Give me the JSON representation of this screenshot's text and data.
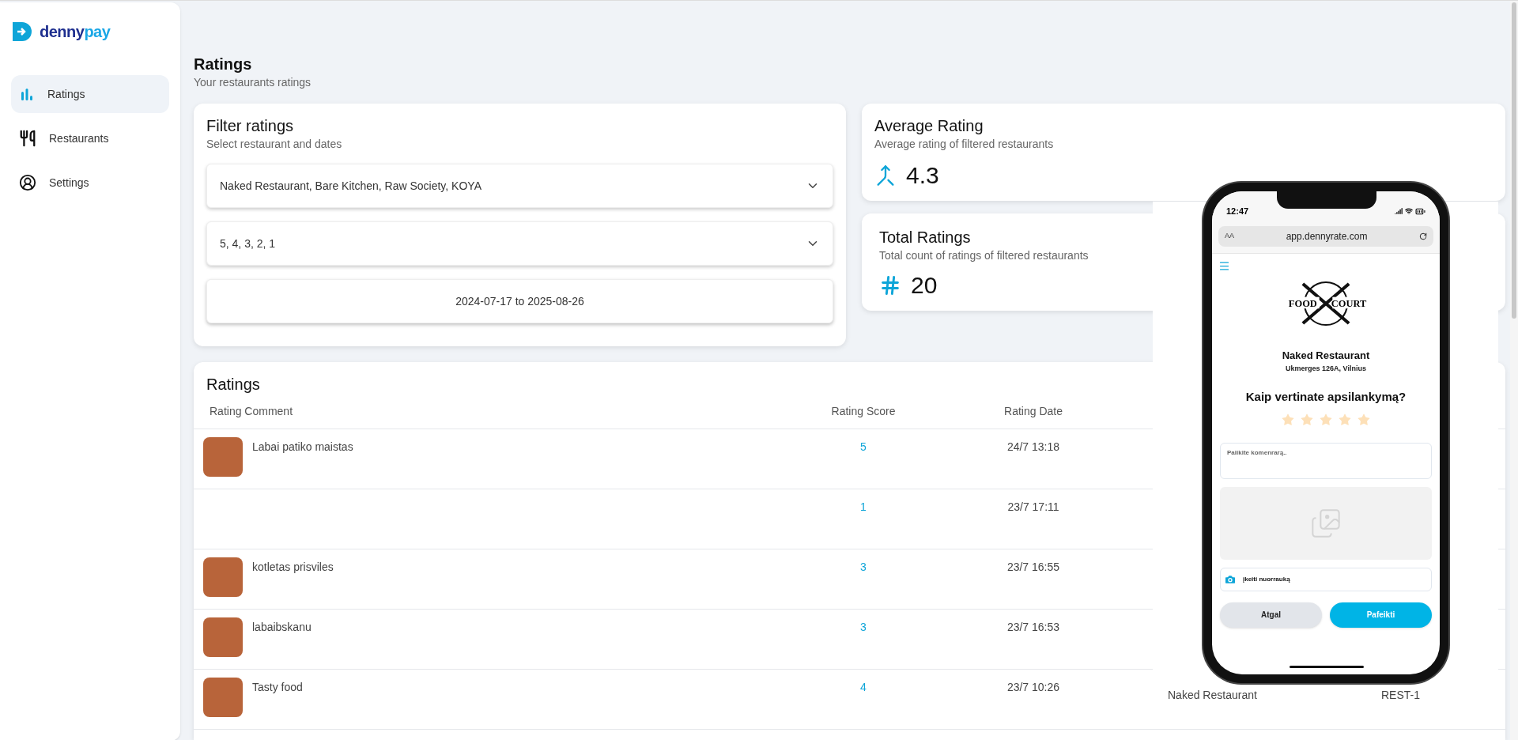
{
  "brand": {
    "first": "denny",
    "second": "pay"
  },
  "sidebar": {
    "items": [
      {
        "kind": "chart",
        "label": "Ratings",
        "selected": true
      },
      {
        "kind": "utensils",
        "label": "Restaurants",
        "selected": false
      },
      {
        "kind": "user",
        "label": "Settings",
        "selected": false
      }
    ]
  },
  "header": {
    "title": "Ratings",
    "subtitle": "Your restaurants ratings"
  },
  "filter": {
    "title": "Filter ratings",
    "subtitle": "Select restaurant and dates",
    "restaurants": "Naked Restaurant, Bare Kitchen, Raw Society, KOYA",
    "scores": "5, 4, 3, 2, 1",
    "date_range": "2024-07-17 to 2025-08-26"
  },
  "average": {
    "title": "Average Rating",
    "subtitle": "Average rating of filtered restaurants",
    "value": "4.3"
  },
  "total": {
    "title": "Total Ratings",
    "subtitle": "Total count of ratings of filtered restaurants",
    "value": "20"
  },
  "table": {
    "title": "Ratings",
    "columns": [
      "Rating Comment",
      "Rating Score",
      "Rating Date"
    ],
    "rows": [
      {
        "photo": true,
        "comment": "Labai patiko maistas",
        "score": "5",
        "date": "24/7 13:18"
      },
      {
        "photo": false,
        "score": "1",
        "date": "23/7 17:11"
      },
      {
        "photo": true,
        "comment": "kotletas prisviles",
        "score": "3",
        "date": "23/7 16:55"
      },
      {
        "photo": true,
        "comment": "labaibskanu",
        "score": "3",
        "date": "23/7 16:53"
      },
      {
        "photo": true,
        "comment": "Tasty food",
        "score": "4",
        "date": "23/7 10:26",
        "restaurant": "Naked Restaurant",
        "id": "REST-1"
      }
    ]
  },
  "phone": {
    "time": "12:47",
    "text_size": "AA",
    "url": "app.dennyrate.com",
    "logo": {
      "left": "FOOD",
      "right": "COURT"
    },
    "restaurant": "Naked Restaurant",
    "address": "Ukmerges 126A, Vilnius",
    "question": "Kaip vertinate apsilankymą?",
    "stars": 5,
    "comment_placeholder": "Paiikite komenrarą..",
    "upload": "įkeiti nuorrauką",
    "back": "Atgal",
    "submit": "Pafeikti"
  }
}
